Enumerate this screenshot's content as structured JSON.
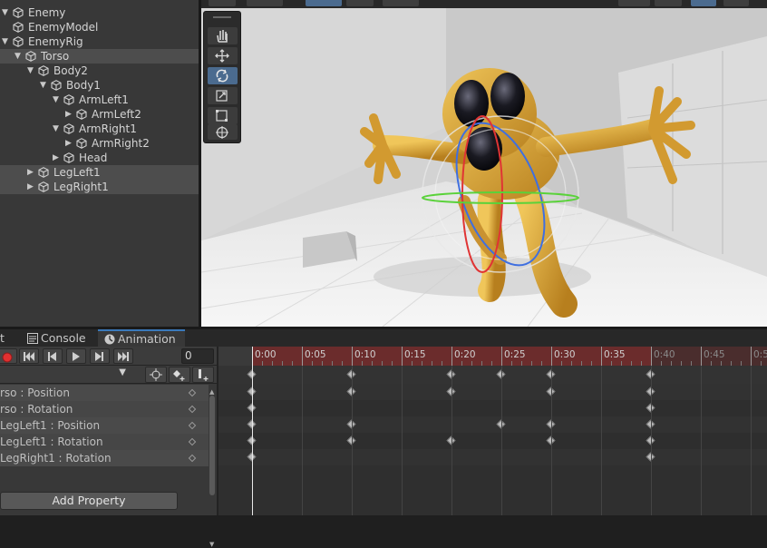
{
  "hierarchy": {
    "rows": [
      {
        "label": "Enemy",
        "depth": 0,
        "arrow": "▼",
        "selected": false
      },
      {
        "label": "EnemyModel",
        "depth": 0,
        "arrow": "",
        "selected": false
      },
      {
        "label": "EnemyRig",
        "depth": 0,
        "arrow": "▼",
        "selected": false
      },
      {
        "label": "Torso",
        "depth": 1,
        "arrow": "▼",
        "selected": true
      },
      {
        "label": "Body2",
        "depth": 2,
        "arrow": "▼",
        "selected": false
      },
      {
        "label": "Body1",
        "depth": 3,
        "arrow": "▼",
        "selected": false
      },
      {
        "label": "ArmLeft1",
        "depth": 4,
        "arrow": "▼",
        "selected": false
      },
      {
        "label": "ArmLeft2",
        "depth": 5,
        "arrow": "▶",
        "selected": false
      },
      {
        "label": "ArmRight1",
        "depth": 4,
        "arrow": "▼",
        "selected": false
      },
      {
        "label": "ArmRight2",
        "depth": 5,
        "arrow": "▶",
        "selected": false
      },
      {
        "label": "Head",
        "depth": 4,
        "arrow": "▶",
        "selected": false
      },
      {
        "label": "LegLeft1",
        "depth": 2,
        "arrow": "▶",
        "selected": true
      },
      {
        "label": "LegRight1",
        "depth": 2,
        "arrow": "▶",
        "selected": true
      }
    ]
  },
  "tabs": [
    {
      "label": "t",
      "icon": "",
      "active": false
    },
    {
      "label": "Console",
      "icon": "console-icon",
      "active": false
    },
    {
      "label": "Animation",
      "icon": "animation-icon",
      "active": true
    }
  ],
  "animation": {
    "frame_value": "0",
    "properties": [
      {
        "label": "rso : Position"
      },
      {
        "label": "rso : Rotation"
      },
      {
        "label": "LegLeft1 : Position"
      },
      {
        "label": "LegLeft1 : Rotation"
      },
      {
        "label": "LegRight1 : Rotation"
      }
    ],
    "add_property_label": "Add Property",
    "timeline": {
      "time_labels": [
        "0:00",
        "0:05",
        "0:10",
        "0:15",
        "0:20",
        "0:25",
        "0:30",
        "0:35",
        "0:40",
        "0:45",
        "0:5"
      ],
      "clip_end_label_index": 8,
      "summary_keys": [
        0,
        10,
        20,
        25,
        30,
        40
      ],
      "row_keys": [
        [
          0,
          10,
          20,
          30,
          40
        ],
        [
          0,
          40
        ],
        [
          0,
          10,
          25,
          30,
          40
        ],
        [
          0,
          10,
          20,
          30,
          40
        ],
        [
          0,
          40
        ]
      ]
    }
  },
  "colors": {
    "record_red": "#e03030",
    "accent_blue": "#3a79bb",
    "character": "#d9a63a"
  }
}
